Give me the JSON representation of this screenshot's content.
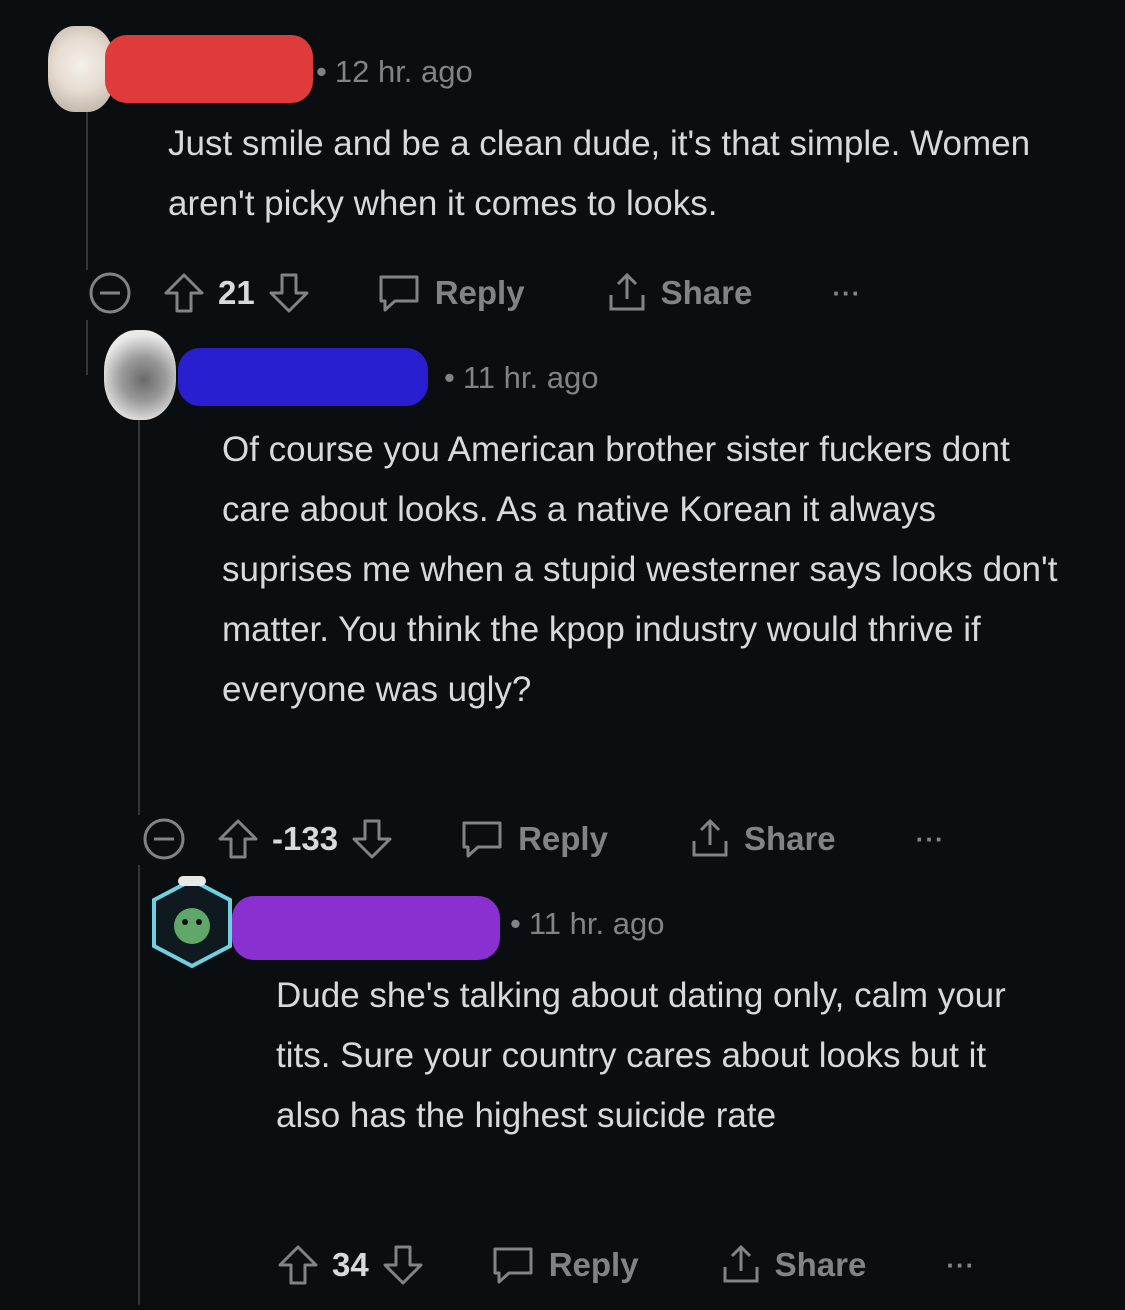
{
  "comments": [
    {
      "time": "12 hr. ago",
      "text": "Just smile and be a clean dude, it's that simple. Women aren't picky when it comes to looks.",
      "score": "21",
      "reply_label": "Reply",
      "share_label": "Share",
      "more_label": "···",
      "name_redaction_color": "#e03b3b"
    },
    {
      "time": "11 hr. ago",
      "text": "Of course you American brother sister fuckers dont care about looks. As a native Korean it always suprises me when a stupid westerner says looks don't matter. You think the kpop industry would thrive if everyone was ugly?",
      "score": "-133",
      "reply_label": "Reply",
      "share_label": "Share",
      "more_label": "···",
      "name_redaction_color": "#2a1fd0"
    },
    {
      "time": "11 hr. ago",
      "text": "Dude she's talking about dating only, calm your tits. Sure your country cares about looks but it also has the highest suicide rate",
      "score": "34",
      "reply_label": "Reply",
      "share_label": "Share",
      "more_label": "···",
      "name_redaction_color": "#8a2fd0"
    }
  ],
  "icons": [
    "collapse-icon",
    "upvote-icon",
    "downvote-icon",
    "reply-bubble-icon",
    "share-icon",
    "more-icon"
  ]
}
